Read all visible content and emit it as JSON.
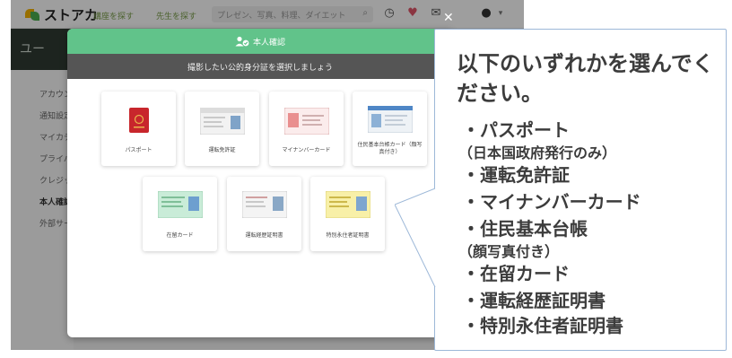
{
  "topbar": {
    "logo_text": "ストアカ",
    "nav_find_class": "講座を探す",
    "nav_find_teacher": "先生を探す",
    "search_placeholder": "プレゼン、写真、料理、ダイエット",
    "icons": [
      "search-icon",
      "history-icon",
      "heart-icon",
      "mail-icon",
      "avatar"
    ]
  },
  "page": {
    "section_title": "ユー",
    "side_items": [
      "アカウン",
      "通知設定",
      "マイカテ",
      "プライバ",
      "クレジッ",
      "本人確認",
      "外部サー"
    ]
  },
  "modal": {
    "title": "本人確認",
    "subtitle": "撮影したい公的身分証を選択しましょう",
    "header_color": "#61c38a",
    "cards": [
      {
        "label": "パスポート",
        "icon": "passport-icon"
      },
      {
        "label": "運転免許証",
        "icon": "drivers-license-icon"
      },
      {
        "label": "マイナンバーカード",
        "icon": "my-number-card-icon"
      },
      {
        "label": "住民基本台帳カード（顔写真付き）",
        "icon": "resident-card-icon"
      },
      {
        "label": "在留カード",
        "icon": "residence-card-icon"
      },
      {
        "label": "運転経歴証明書",
        "icon": "driving-record-icon"
      },
      {
        "label": "特別永住者証明書",
        "icon": "special-resident-icon"
      }
    ]
  },
  "callout": {
    "heading": "以下のいずれかを選んでください。",
    "items": [
      "・パスポート",
      "（日本国政府発行のみ）",
      "・運転免許証",
      "・マイナンバーカード",
      "・住民基本台帳",
      "（顔写真付き）",
      "・在留カード",
      "・運転経歴証明書",
      "・特別永住者証明書"
    ]
  }
}
